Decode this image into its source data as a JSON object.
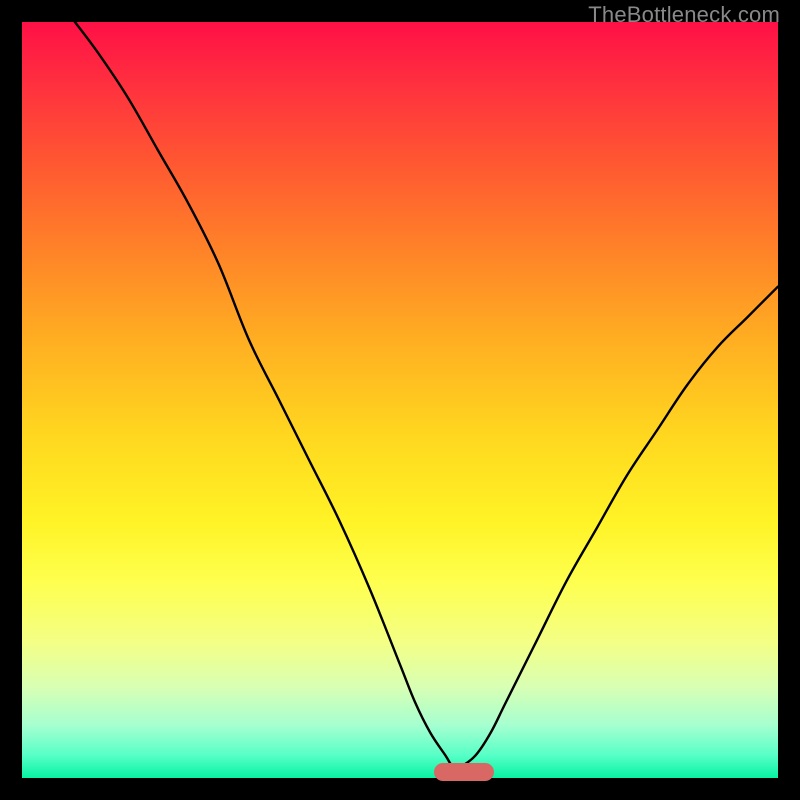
{
  "watermark": "TheBottleneck.com",
  "colors": {
    "curve_stroke": "#000000",
    "marker_fill": "#d96864",
    "gradient_top": "#ff1046",
    "gradient_bottom": "#06f3a1"
  },
  "chart_data": {
    "type": "line",
    "title": "",
    "xlabel": "",
    "ylabel": "",
    "xlim": [
      0,
      100
    ],
    "ylim": [
      0,
      100
    ],
    "series": [
      {
        "name": "bottleneck-curve",
        "x": [
          7,
          10,
          14,
          18,
          22,
          26,
          30,
          34,
          38,
          42,
          46,
          50,
          52,
          54,
          56,
          57,
          58,
          60,
          62,
          64,
          68,
          72,
          76,
          80,
          84,
          88,
          92,
          96,
          100
        ],
        "y": [
          100,
          96,
          90,
          83,
          76,
          68,
          58,
          50,
          42,
          34,
          25,
          15,
          10,
          6,
          3,
          1.5,
          1.5,
          3,
          6,
          10,
          18,
          26,
          33,
          40,
          46,
          52,
          57,
          61,
          65
        ]
      }
    ],
    "marker": {
      "x_start": 54.5,
      "x_end": 62.5,
      "y": 0.8
    },
    "notes": "V-shaped bottleneck curve on a vertical rainbow gradient; minimum near x≈58. Values are visual estimates (no axes labeled)."
  }
}
